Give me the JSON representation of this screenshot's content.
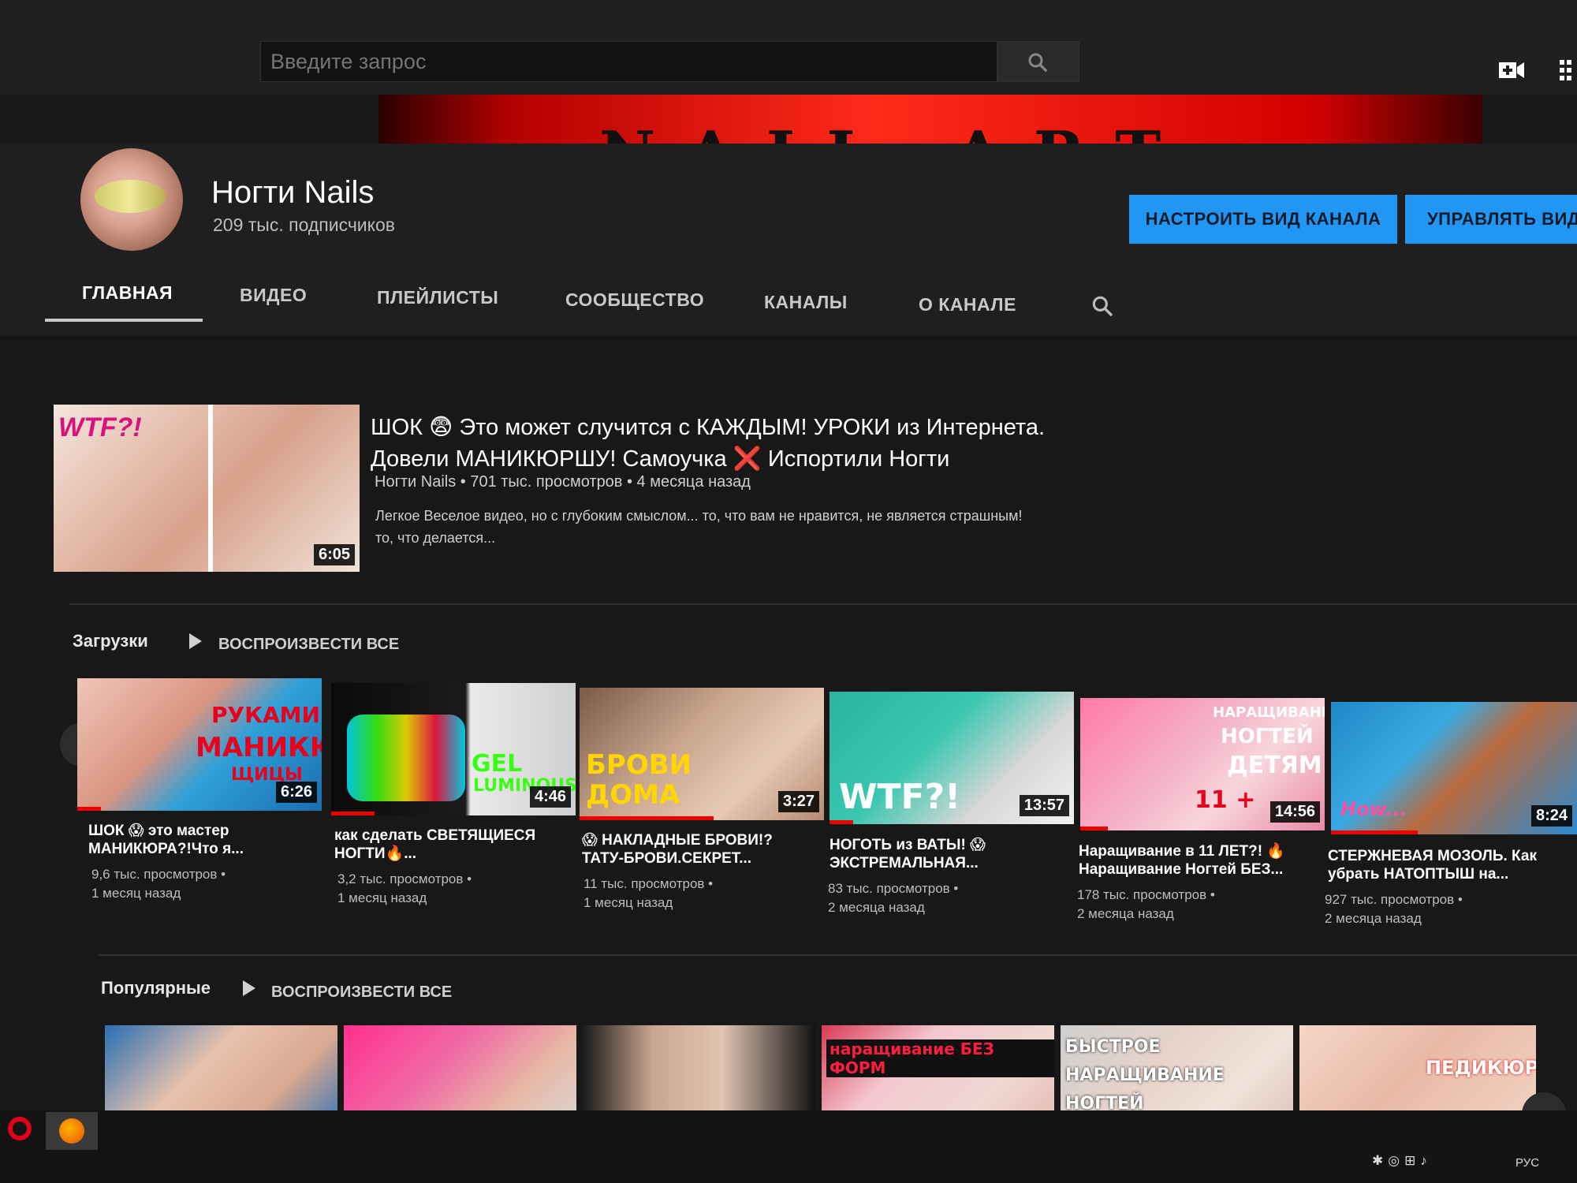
{
  "search": {
    "placeholder": "Введите запрос"
  },
  "channel": {
    "name": "Ногти Nails",
    "subscribers": "209 тыс. подписчиков",
    "banner_text": "NAIL ART"
  },
  "buttons": {
    "customize": "НАСТРОИТЬ ВИД КАНАЛА",
    "manage": "УПРАВЛЯТЬ ВИД"
  },
  "tabs": [
    {
      "label": "ГЛАВНАЯ",
      "active": true
    },
    {
      "label": "ВИДЕО"
    },
    {
      "label": "ПЛЕЙЛИСТЫ"
    },
    {
      "label": "СООБЩЕСТВО"
    },
    {
      "label": "КАНАЛЫ"
    },
    {
      "label": "О КАНАЛЕ"
    }
  ],
  "featured": {
    "title_line1": "ШОК 😨 Это может случится с КАЖДЫМ! УРОКИ из Интернета.",
    "title_line2": "Довели МАНИКЮРШУ! Самоучка ❌ Испортили Ногти",
    "meta": "Ногти Nails • 701 тыс. просмотров • 4 месяца назад",
    "desc_line1": "Легкое Веселое видео, но с глубоким смыслом... то, что вам не нравится, не является страшным!",
    "desc_line2": "то, что делается...",
    "duration": "6:05",
    "thumb_text": "WTF?!"
  },
  "uploads": {
    "title": "Загрузки",
    "play_all": "ВОСПРОИЗВЕСТИ ВСЕ",
    "videos": [
      {
        "title_line1": "ШОК 😱 это мастер",
        "title_line2": "МАНИКЮРА?!Что я...",
        "views": "9,6 тыс. просмотров •",
        "age": "1 месяц назад",
        "duration": "6:26",
        "thumb_text1": "РУКАМИ",
        "thumb_text2": "МАНИКЮР",
        "thumb_text3": "ЩИЦЫ"
      },
      {
        "title_line1": "как сделать СВЕТЯЩИЕСЯ",
        "title_line2": "НОГТИ🔥...",
        "views": "3,2 тыс. просмотров •",
        "age": "1 месяц назад",
        "duration": "4:46",
        "thumb_text1": "GEL",
        "thumb_text2": "LUMINOUS"
      },
      {
        "title_line1": "😱 НАКЛАДНЫЕ БРОВИ!?",
        "title_line2": "ТАТУ-БРОВИ.СЕКРЕТ...",
        "views": "11 тыс. просмотров •",
        "age": "1 месяц назад",
        "duration": "3:27",
        "thumb_text1": "БРОВИ",
        "thumb_text2": "ДОМА"
      },
      {
        "title_line1": "НОГОТЬ из ВАТЫ! 😱",
        "title_line2": "ЭКСТРЕМАЛЬНАЯ...",
        "views": "83 тыс. просмотров •",
        "age": "2 месяца назад",
        "duration": "13:57",
        "thumb_text1": "WTF?!"
      },
      {
        "title_line1": "Наращивание в 11 ЛЕТ?! 🔥",
        "title_line2": "Наращивание Ногтей БЕЗ...",
        "views": "178 тыс. просмотров •",
        "age": "2 месяца назад",
        "duration": "14:56",
        "thumb_text1": "НАРАЩИВАНИЕ",
        "thumb_text2": "НОГТЕЙ",
        "thumb_text3": "ДЕТЯМ",
        "thumb_text4": "11 +"
      },
      {
        "title_line1": "СТЕРЖНЕВАЯ МОЗОЛЬ. Как",
        "title_line2": "убрать НАТОПТЫШ на...",
        "views": "927 тыс. просмотров •",
        "age": "2 месяца назад",
        "duration": "8:24",
        "thumb_text1": "How..."
      }
    ]
  },
  "popular": {
    "title": "Популярные",
    "play_all": "ВОСПРОИЗВЕСТИ ВСЕ",
    "thumb_texts": [
      "",
      "",
      "",
      "наращивание БЕЗ ФОРМ",
      "БЫСТРОЕ НАРАЩИВАНИЕ НОГТЕЙ",
      "ПЕДИКЮР"
    ]
  },
  "taskbar": {
    "lang": "РУС"
  },
  "colors": {
    "accent": "#2196f3",
    "progress": "#e00000",
    "background": "#181818"
  }
}
